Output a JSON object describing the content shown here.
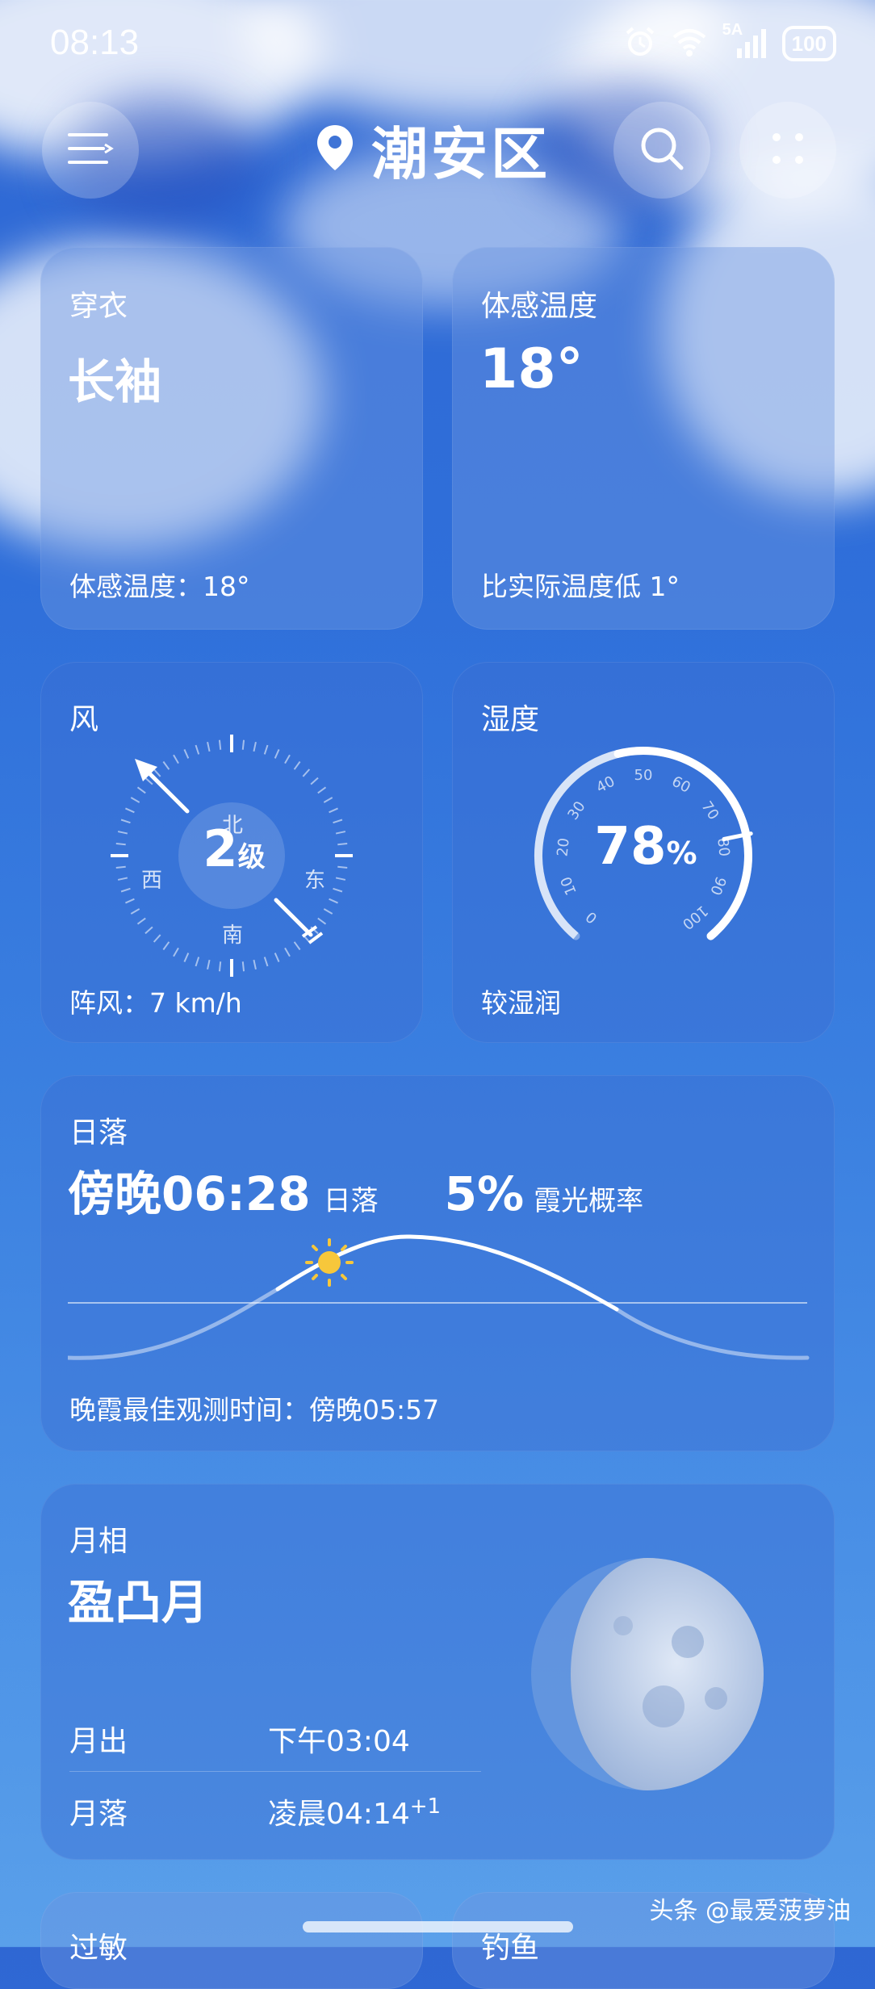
{
  "status": {
    "time": "08:13",
    "network": "5A",
    "battery": "100"
  },
  "header": {
    "city": "潮安区"
  },
  "clothing": {
    "title": "穿衣",
    "value": "长袖",
    "footer_label": "体感温度：",
    "footer_value": "18°"
  },
  "feels_like": {
    "title": "体感温度",
    "value": "18°",
    "footer": "比实际温度低 1°"
  },
  "wind": {
    "title": "风",
    "level": "2",
    "unit": "级",
    "north": "北",
    "south": "南",
    "east": "东",
    "west": "西",
    "gust_label": "阵风：",
    "gust_value": "7 km/h"
  },
  "humidity": {
    "title": "湿度",
    "value": "78",
    "unit": "%",
    "description": "较湿润",
    "scale": [
      "0",
      "10",
      "20",
      "30",
      "40",
      "50",
      "60",
      "70",
      "80",
      "90",
      "100"
    ]
  },
  "sunset": {
    "title": "日落",
    "time": "傍晚06:28",
    "time_suffix": "日落",
    "probability": "5%",
    "probability_label": "霞光概率",
    "best_label": "晚霞最佳观测时间：",
    "best_value": "傍晚05:57"
  },
  "moon": {
    "title": "月相",
    "phase": "盈凸月",
    "rise_label": "月出",
    "rise_value": "下午03:04",
    "set_label": "月落",
    "set_value": "凌晨04:14",
    "set_sup": "+1"
  },
  "bottom": {
    "left_title": "过敏",
    "right_title": "钓鱼"
  },
  "watermark": "头条 @最爱菠萝油"
}
